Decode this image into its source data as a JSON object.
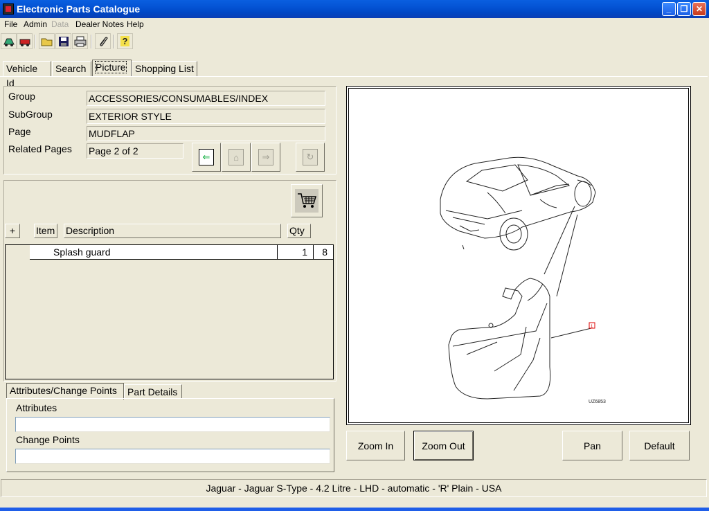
{
  "window": {
    "title": "Electronic Parts Catalogue"
  },
  "menu": [
    {
      "label": "File",
      "enabled": true
    },
    {
      "label": "Admin",
      "enabled": true
    },
    {
      "label": "Data",
      "enabled": false
    },
    {
      "label": "Dealer Notes",
      "enabled": true
    },
    {
      "label": "Help",
      "enabled": true
    }
  ],
  "toolbar": {
    "icons": [
      "vehicle-icon",
      "car-icon",
      "open-folder-icon",
      "save-icon",
      "print-icon",
      "paperclip-icon",
      "help-icon"
    ],
    "help_glyph": "?"
  },
  "tabs": [
    {
      "label": "Vehicle Id",
      "active": false
    },
    {
      "label": "Search",
      "active": false
    },
    {
      "label": "Picture",
      "active": true
    },
    {
      "label": "Shopping List",
      "active": false
    }
  ],
  "info": {
    "group_label": "Group",
    "group_value": "ACCESSORIES/CONSUMABLES/INDEX",
    "subgroup_label": "SubGroup",
    "subgroup_value": "EXTERIOR STYLE",
    "page_label": "Page",
    "page_value": "MUDFLAP",
    "related_label": "Related Pages",
    "related_value": "Page 2 of 2"
  },
  "parts": {
    "headers": {
      "plus": "+",
      "item": "Item",
      "description": "Description",
      "qty": "Qty"
    },
    "rows": [
      {
        "description": "Splash guard",
        "qty": "1",
        "ref": "8"
      }
    ]
  },
  "detail_tabs": [
    {
      "label": "Attributes/Change Points",
      "active": true
    },
    {
      "label": "Part Details",
      "active": false
    }
  ],
  "attributes": {
    "attributes_label": "Attributes",
    "change_points_label": "Change Points",
    "attributes_value": "",
    "change_points_value": ""
  },
  "picture": {
    "callout": "1",
    "drawing_id": "UZ6853"
  },
  "buttons": {
    "zoom_in": "Zoom In",
    "zoom_out": "Zoom Out",
    "pan": "Pan",
    "default": "Default"
  },
  "status": {
    "vehicle": "Jaguar - Jaguar S-Type - 4.2 Litre - LHD - automatic - 'R' Plain - USA"
  }
}
